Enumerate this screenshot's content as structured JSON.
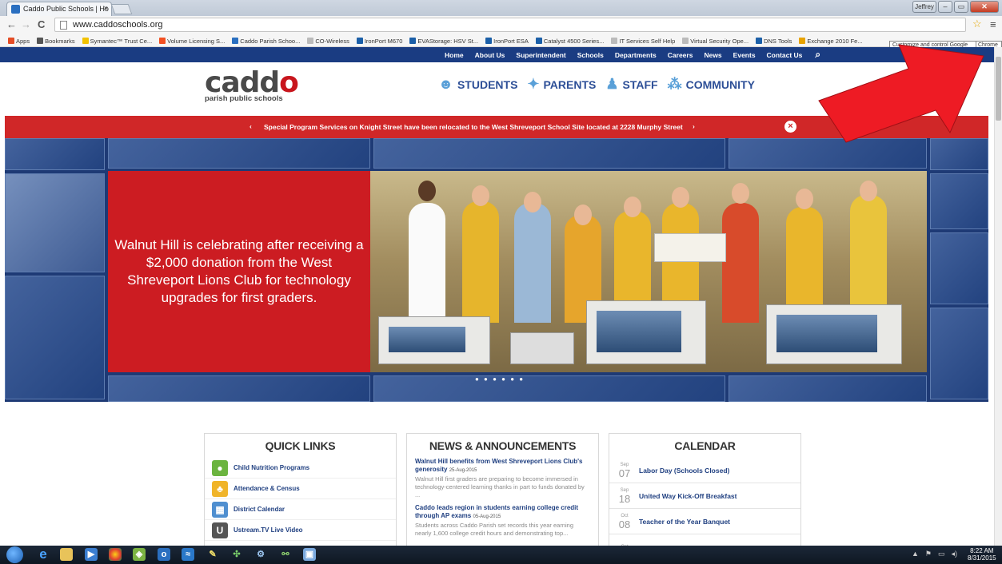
{
  "browser": {
    "tab_title": "Caddo Public Schools | Ho",
    "tab_close": "×",
    "url": "www.caddoschools.org",
    "back": "←",
    "forward": "→",
    "reload": "C",
    "user_button": "Jeffrey",
    "tooltip_left": "Customize and control Google",
    "tooltip_right": "Chrome",
    "bookmarks": [
      {
        "label": "Apps",
        "icon": "apps-icon",
        "color": "#e44d26"
      },
      {
        "label": "Bookmarks",
        "icon": "star-icon",
        "color": "#555555"
      },
      {
        "label": "Symantec™ Trust Ce...",
        "icon": "check-icon",
        "color": "#f2c200"
      },
      {
        "label": "Volume Licensing S...",
        "icon": "windows-icon",
        "color": "#f25022"
      },
      {
        "label": "Caddo Parish Schoo...",
        "icon": "site-icon",
        "color": "#2a6fc0"
      },
      {
        "label": "CO-Wireless",
        "icon": "page-icon",
        "color": "#bbbbbb"
      },
      {
        "label": "IronPort M670",
        "icon": "cisco-icon",
        "color": "#1b5fa8"
      },
      {
        "label": "EVAStorage: HSV St...",
        "icon": "storage-icon",
        "color": "#1b5fa8"
      },
      {
        "label": "IronPort ESA",
        "icon": "cisco-icon",
        "color": "#1b5fa8"
      },
      {
        "label": "Catalyst 4500 Series...",
        "icon": "cisco-icon",
        "color": "#1b5fa8"
      },
      {
        "label": "IT Services Self Help",
        "icon": "page-icon",
        "color": "#bbbbbb"
      },
      {
        "label": "Virtual Security Ope...",
        "icon": "page-icon",
        "color": "#bbbbbb"
      },
      {
        "label": "DNS Tools",
        "icon": "dns-icon",
        "color": "#1b5fa8"
      },
      {
        "label": "Exchange 2010 Fe...",
        "icon": "exchange-icon",
        "color": "#e8a300"
      }
    ]
  },
  "site": {
    "topnav": [
      "Home",
      "About Us",
      "Superintendent",
      "Schools",
      "Departments",
      "Careers",
      "News",
      "Events",
      "Contact Us"
    ],
    "logo_main_1": "cadd",
    "logo_main_2": "o",
    "logo_sub": "parish public schools",
    "audiences": [
      "STUDENTS",
      "PARENTS",
      "STAFF",
      "COMMUNITY"
    ],
    "alert": {
      "prev": "‹",
      "message": "Special Program Services on Knight Street have been relocated to the West Shreveport School Site located at 2228 Murphy Street",
      "next": "›",
      "close": "×"
    },
    "slide_caption": "Walnut Hill is celebrating after receiving a $2,000 donation from the West Shreveport Lions Club for technology upgrades for first graders.",
    "slide_dots": "● ● ● ● ● ●",
    "quick_links": {
      "title": "QUICK LINKS",
      "items": [
        {
          "label": "Child Nutrition Programs",
          "color": "#6bb43f",
          "glyph": "●"
        },
        {
          "label": "Attendance & Census",
          "color": "#f0b429",
          "glyph": "♣"
        },
        {
          "label": "District Calendar",
          "color": "#4f8fd0",
          "glyph": "▦"
        },
        {
          "label": "Ustream.TV Live Video",
          "color": "#555555",
          "glyph": "U"
        }
      ]
    },
    "news": {
      "title": "NEWS & ANNOUNCEMENTS",
      "items": [
        {
          "title": "Walnut Hill benefits from West Shreveport Lions Club's generosity",
          "date": "25-Aug-2015",
          "body": "Walnut Hill first graders are preparing to become immersed in technology-centered learning thanks in part to funds donated by ..."
        },
        {
          "title": "Caddo leads region in students earning college credit through AP exams",
          "date": "05-Aug-2015",
          "body": "Students across Caddo Parish set records this year earning nearly 1,600 college credit hours and demonstrating top..."
        }
      ]
    },
    "calendar": {
      "title": "CALENDAR",
      "items": [
        {
          "month": "Sep",
          "day": "07",
          "label": "Labor Day (Schools Closed)"
        },
        {
          "month": "Sep",
          "day": "18",
          "label": "United Way Kick-Off Breakfast"
        },
        {
          "month": "Oct",
          "day": "08",
          "label": "Teacher of the Year Banquet"
        },
        {
          "month": "Oct",
          "day": "",
          "label": ""
        }
      ]
    }
  },
  "taskbar": {
    "time": "8:22 AM",
    "date": "8/31/2015"
  }
}
